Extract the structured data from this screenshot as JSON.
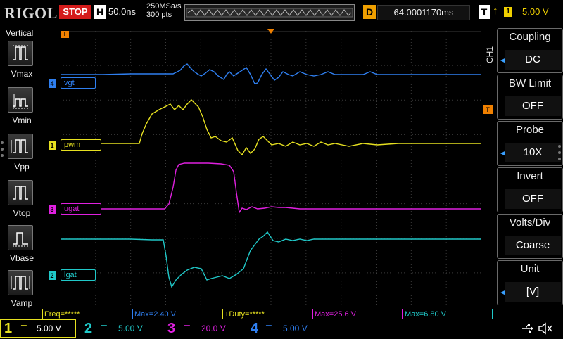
{
  "topbar": {
    "brand": "RIGOL",
    "run_status": "STOP",
    "horizontal_label": "H",
    "timebase": "50.0ns",
    "sample_rate": "250MSa/s",
    "memory_depth": "300 pts",
    "delay_label": "D",
    "delay_value": "64.0001170ms",
    "trigger_label": "T",
    "trigger_source": "1",
    "trigger_level": "5.00 V"
  },
  "left_panel": {
    "title": "Vertical",
    "items": [
      {
        "label": "Vmax",
        "icon": "vmax-icon"
      },
      {
        "label": "Vmin",
        "icon": "vmin-icon"
      },
      {
        "label": "Vpp",
        "icon": "vpp-icon"
      },
      {
        "label": "Vtop",
        "icon": "vtop-icon"
      },
      {
        "label": "Vbase",
        "icon": "vbase-icon"
      },
      {
        "label": "Vamp",
        "icon": "vamp-icon"
      }
    ]
  },
  "screen": {
    "trigger_time_marker": "T",
    "trigger_level_marker": "T",
    "channels": [
      {
        "num": "4",
        "name": "vgt",
        "color": "#2f7ff0"
      },
      {
        "num": "1",
        "name": "pwm",
        "color": "#e6e020"
      },
      {
        "num": "3",
        "name": "ugat",
        "color": "#e020e0"
      },
      {
        "num": "2",
        "name": "lgat",
        "color": "#20c8c8"
      }
    ]
  },
  "right_menu": {
    "channel_tab": "CH1",
    "items": [
      {
        "title": "Coupling",
        "value": "DC",
        "has_arrow": true
      },
      {
        "title": "BW Limit",
        "value": "OFF",
        "has_arrow": false
      },
      {
        "title": "Probe",
        "value": "10X",
        "has_arrow": true
      },
      {
        "title": "Invert",
        "value": "OFF",
        "has_arrow": false
      },
      {
        "title": "Volts/Div",
        "value": "Coarse",
        "has_arrow": false
      },
      {
        "title": "Unit",
        "value": "[V]",
        "has_arrow": true
      }
    ]
  },
  "measurements": [
    {
      "text": "Freq=*****",
      "color": "#e6e020"
    },
    {
      "text": "Max=2.40 V",
      "color": "#2f7ff0"
    },
    {
      "text": "+Duty=*****",
      "color": "#e6e020"
    },
    {
      "text": "Max=25.6 V",
      "color": "#e020e0"
    },
    {
      "text": "Max=6.80 V",
      "color": "#20c8c8"
    }
  ],
  "bottom_bar": {
    "channels": [
      {
        "num": "1",
        "scale": "5.00 V",
        "color": "#e6e020"
      },
      {
        "num": "2",
        "scale": "5.00 V",
        "color": "#20c8c8"
      },
      {
        "num": "3",
        "scale": "20.0 V",
        "color": "#e020e0"
      },
      {
        "num": "4",
        "scale": "5.00 V",
        "color": "#2f7ff0"
      }
    ],
    "usb_icon": "usb-icon",
    "sound_icon": "speaker-muted-icon"
  },
  "colors": {
    "grid": "#3a3a3a",
    "stop_red": "#d41b1b",
    "delay_orange": "#f0a000",
    "trigger_marker": "#f08000"
  }
}
